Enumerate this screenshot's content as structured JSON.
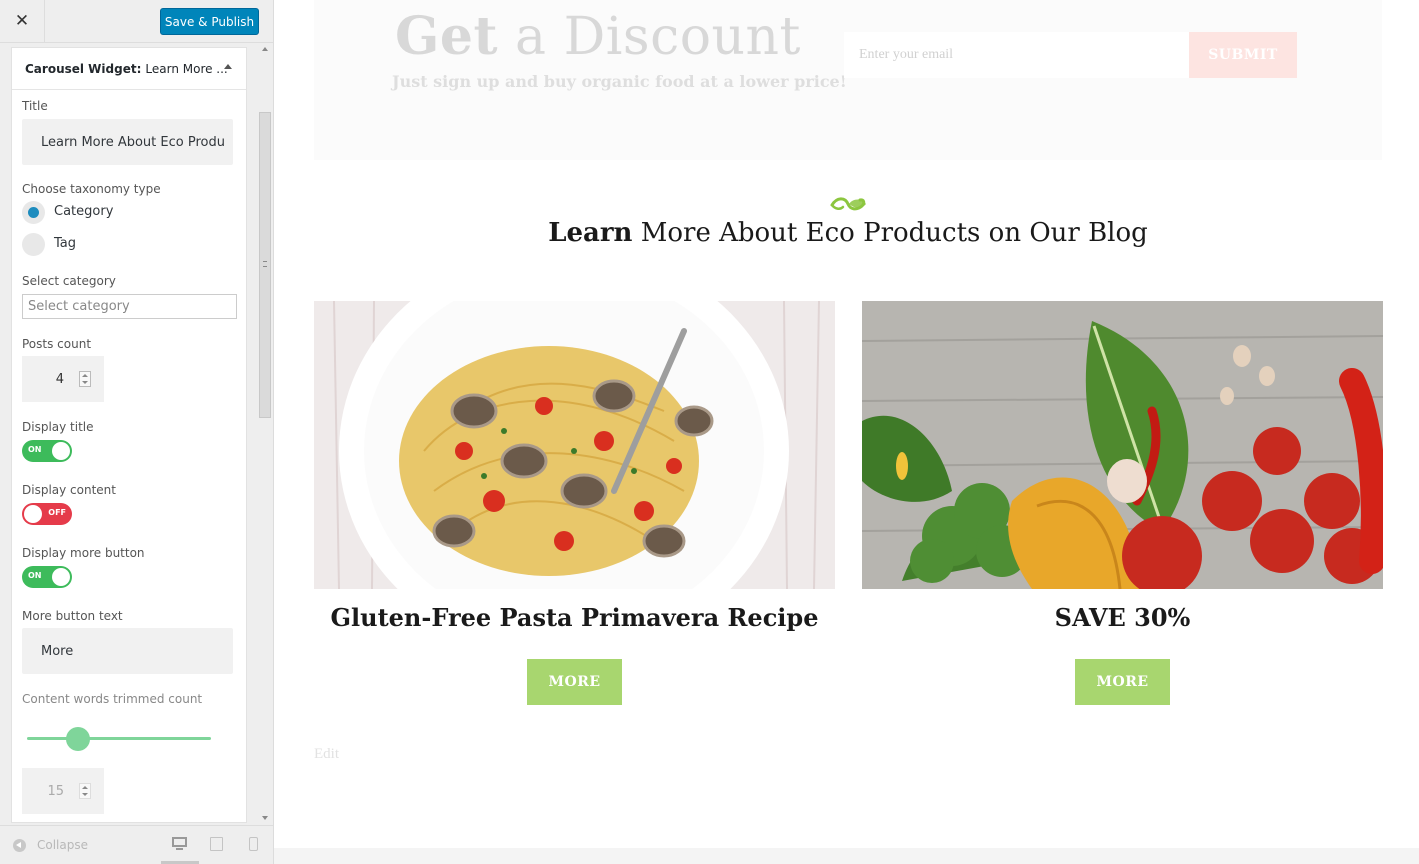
{
  "toolbar": {
    "close_icon": "close-icon",
    "publish_label": "Save & Publish",
    "publish_color": "#0085ba"
  },
  "widget": {
    "header_bold": "Carousel Widget:",
    "header_rest": "Learn More ...",
    "title_label": "Title",
    "title_value": "Learn More About Eco Produ",
    "taxonomy_label": "Choose taxonomy type",
    "taxonomy_options": [
      "Category",
      "Tag"
    ],
    "taxonomy_selected": "Category",
    "category_label": "Select category",
    "category_placeholder": "Select category",
    "posts_count_label": "Posts count",
    "posts_count_value": "4",
    "display_title_label": "Display title",
    "display_title_state": "ON",
    "display_content_label": "Display content",
    "display_content_state": "OFF",
    "display_more_label": "Display more button",
    "display_more_state": "ON",
    "more_text_label": "More button text",
    "more_text_value": "More",
    "trim_label": "Content words trimmed count",
    "trim_value": "15",
    "toggle_on_color": "#3dbb5b",
    "toggle_off_color": "#e53b4a",
    "slider_color": "#7fd59a"
  },
  "footer": {
    "collapse_label": "Collapse",
    "devices": [
      "desktop-icon",
      "tablet-icon",
      "mobile-icon"
    ],
    "active_device": "desktop"
  },
  "preview": {
    "discount": {
      "title_bold": "Get",
      "title_rest": " a Discount",
      "subtitle": "Just sign up and buy organic food at a lower price!",
      "email_placeholder": "Enter your email",
      "submit_label": "SUBMIT"
    },
    "blog": {
      "ornament_icon": "leaf-swirl-icon",
      "title_bold": "Learn",
      "title_rest": " More About Eco Products on Our Blog",
      "posts": [
        {
          "title": "Gluten-Free Pasta Primavera Recipe",
          "button": "MORE",
          "image": "pasta-clams-photo"
        },
        {
          "title": "SAVE 30%",
          "button": "MORE",
          "image": "vegetables-photo"
        }
      ],
      "accent_color": "#a8d66f"
    },
    "edit_label": "Edit"
  }
}
